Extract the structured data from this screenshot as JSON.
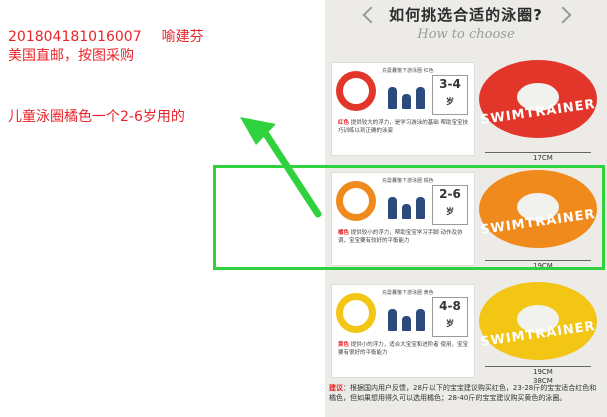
{
  "notes": {
    "order_id": "201804181016007",
    "customer": "喻建芬",
    "shipping": "美国直邮，按图采购",
    "request": "儿童泳圈橘色一个2-6岁用的"
  },
  "catalog": {
    "title": "如何挑选合适的泳圈?",
    "subtitle": "How to choose",
    "products": [
      {
        "caption": "充曼囊箍下游泳圈 红色",
        "age": "3-4",
        "unit": "岁",
        "desc_color": "红色",
        "desc": "提供较大的浮力，是学习游泳的基础 帮助宝宝技巧训练以到正确的泳姿",
        "ring_text": "SWIMTRAINER",
        "size": "17CM",
        "color": "#e3362b"
      },
      {
        "caption": "充曼囊箍下游泳圈 橘色",
        "age": "2-6",
        "unit": "岁",
        "desc_color": "橘色",
        "desc": "提供较小的浮力，帮助宝宝学习手脚 动作及协调，宝宝要有较好的平衡能力",
        "ring_text": "SWIMTRAINER",
        "size": "19CM",
        "color": "#f08a1d"
      },
      {
        "caption": "充曼囊箍下游泳圈 黄色",
        "age": "4-8",
        "unit": "岁",
        "desc_color": "黄色",
        "desc": "提供小的浮力，适合大宝宝和进阶者 使用，宝宝要有很好的平衡能力",
        "ring_text": "SWIMTRAINER",
        "size": "19CM",
        "size2": "38CM",
        "color": "#f3c514"
      }
    ],
    "advice_label": "建议",
    "advice": "：根据国内用户反馈，28斤以下的宝宝建议购买红色，23-28斤的宝宝适合红色和橘色，但如果想用得久可以选用橘色；28-40斤的宝宝建议购买黄色的泳圈。"
  },
  "colors": {
    "note_red": "#e8242a",
    "highlight_green": "#2fd23c"
  }
}
